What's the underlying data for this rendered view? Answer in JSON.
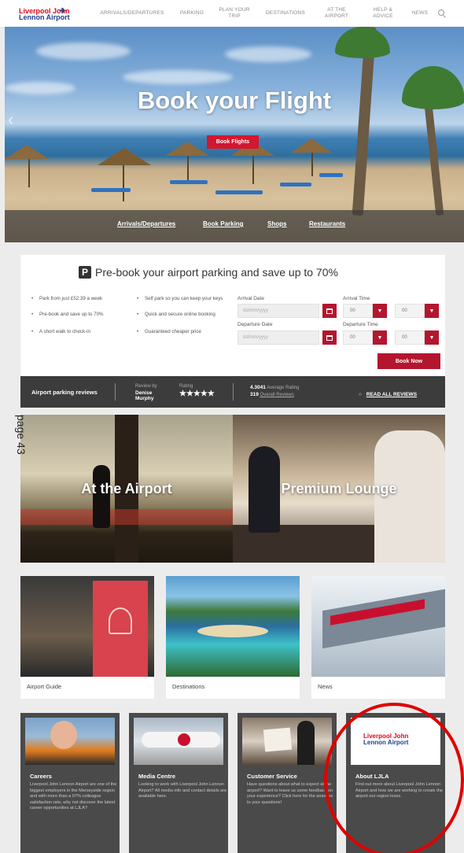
{
  "header": {
    "logo_line1": "Liverpool John",
    "logo_line2": "Lennon Airport",
    "nav": [
      {
        "label": "ARRIVALS/DEPARTURES"
      },
      {
        "label": "PARKING"
      },
      {
        "label": "PLAN YOUR TRIP"
      },
      {
        "label": "DESTINATIONS"
      },
      {
        "label": "AT THE AIRPORT"
      },
      {
        "label": "HELP & ADVICE"
      },
      {
        "label": "NEWS"
      }
    ]
  },
  "hero": {
    "title": "Book your Flight",
    "button": "Book Flights",
    "links": [
      "Arrivals/Departures",
      "Book Parking",
      "Shops",
      "Restaurants"
    ]
  },
  "parking": {
    "title": "Pre-book your airport parking and save up to 70%",
    "bullets_left": [
      "Park from just £52.39 a week",
      "Pre-book and save up to 70%",
      "A short walk to check-in"
    ],
    "bullets_right": [
      "Self park so you can keep your keys",
      "Quick and secure online booking",
      "Guaranteed cheaper price"
    ],
    "arrival_date_label": "Arrival Date",
    "arrival_time_label": "Arrival Time",
    "departure_date_label": "Departure Date",
    "departure_time_label": "Departure Time",
    "date_placeholder": "dd/mm/yyyy",
    "time_value": "00",
    "book_now": "Book Now"
  },
  "reviews": {
    "title": "Airport parking reviews",
    "review_by_label": "Review by",
    "reviewer": "Denise Murphy",
    "rating_label": "Rating",
    "stars": "★★★★★",
    "avg_value": "4.3041",
    "avg_label": "Average Rating",
    "overall_count": "319",
    "overall_label": "Overall Reviews",
    "read_all": "READ ALL REVIEWS"
  },
  "tiles": [
    {
      "label": "At the Airport"
    },
    {
      "label": "Premium Lounge"
    }
  ],
  "annotation": "page 43",
  "cards": [
    {
      "label": "Airport Guide"
    },
    {
      "label": "Destinations"
    },
    {
      "label": "News"
    }
  ],
  "dark_cards": [
    {
      "title": "Careers",
      "text": "Liverpool John Lennon Airport are one of the biggest employers in the Merseyside region and with more than a 97% colleague satisfaction rate, why not discover the latest career opportunities at LJLA?"
    },
    {
      "title": "Media Centre",
      "text": "Looking to work with Liverpool John Lennon Airport? All media info and contact details are available here."
    },
    {
      "title": "Customer Service",
      "text": "Have questions about what to expect at the airport? Want to leave us some feedback on your experience? Click here for the answers to your questions!"
    },
    {
      "title": "About LJLA",
      "text": "Find out more about Liverpool John Lennon Airport and how we are working to create the airport our region loves."
    }
  ],
  "colors": {
    "brand_red": "#b3162e",
    "dark_panel": "#3c3c3c",
    "highlight_circle": "#e00000"
  }
}
